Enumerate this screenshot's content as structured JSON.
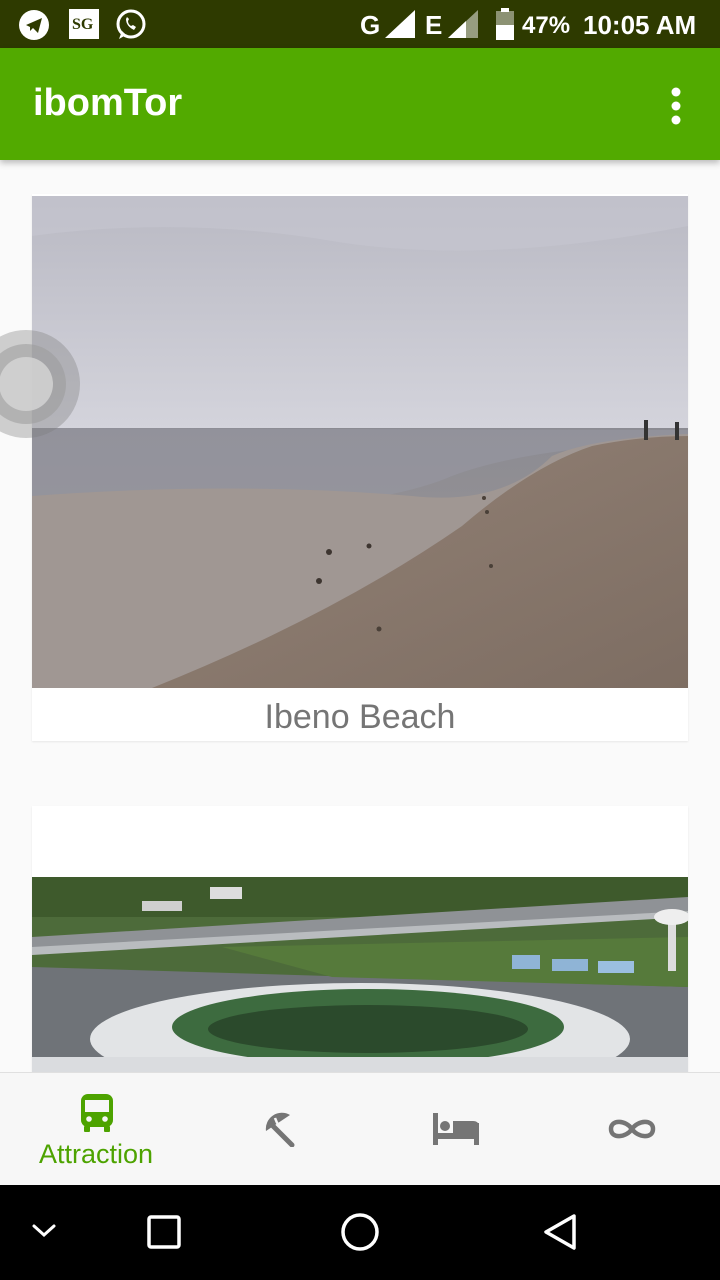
{
  "status_bar": {
    "icons": [
      "telegram-icon",
      "sg-app-icon",
      "whatsapp-icon",
      "network-g-icon",
      "network-e-icon",
      "battery-icon"
    ],
    "sg_text": "SG",
    "network_1": "G",
    "network_2": "E",
    "battery": "47%",
    "time": "10:05 AM"
  },
  "app_bar": {
    "title": "ibomTor",
    "menu_icon": "more-vert-icon"
  },
  "cards": [
    {
      "label": "Ibeno Beach",
      "image": "beach-photo"
    },
    {
      "label": "",
      "image": "stadium-photo"
    }
  ],
  "bottom_nav": {
    "items": [
      {
        "label": "Attraction",
        "icon": "bus-icon",
        "active": true
      },
      {
        "label": "",
        "icon": "beach-umbrella-icon",
        "active": false
      },
      {
        "label": "",
        "icon": "hotel-bed-icon",
        "active": false
      },
      {
        "label": "",
        "icon": "infinity-icon",
        "active": false
      }
    ]
  },
  "colors": {
    "primary": "#52aa00",
    "status_bar": "#2e3a00",
    "active_nav": "#4da300",
    "inactive_nav": "#757575"
  },
  "system_nav": [
    "collapse-icon",
    "recents-icon",
    "home-icon",
    "back-icon"
  ]
}
